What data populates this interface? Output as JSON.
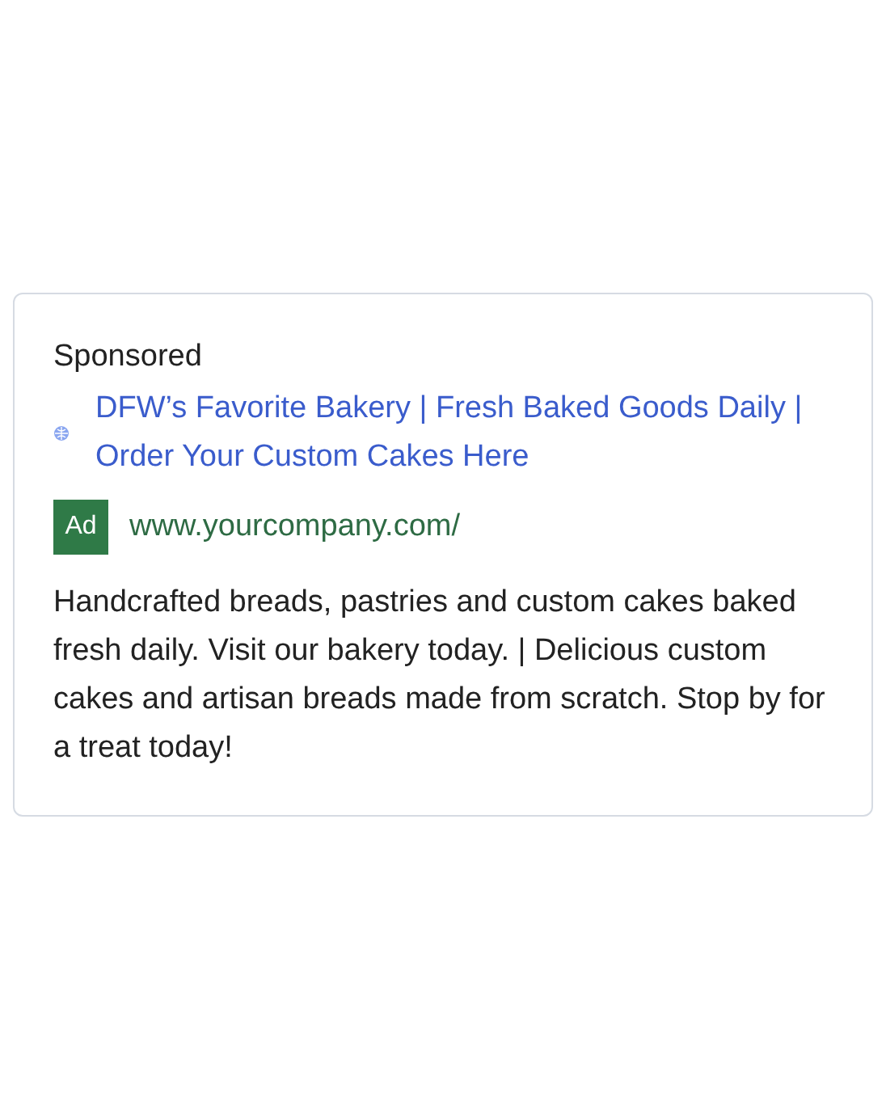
{
  "ad": {
    "label": "Sponsored",
    "headline": "DFW’s Favorite Bakery | Fresh Baked Goods Daily | Order Your Custom Cakes Here",
    "badge": "Ad",
    "url": "www.yourcompany.com/",
    "description": "Handcrafted breads, pastries and custom cakes baked fresh daily. Visit our bakery today. | Delicious custom cakes and artisan breads made from scratch. Stop by for a treat today!"
  }
}
